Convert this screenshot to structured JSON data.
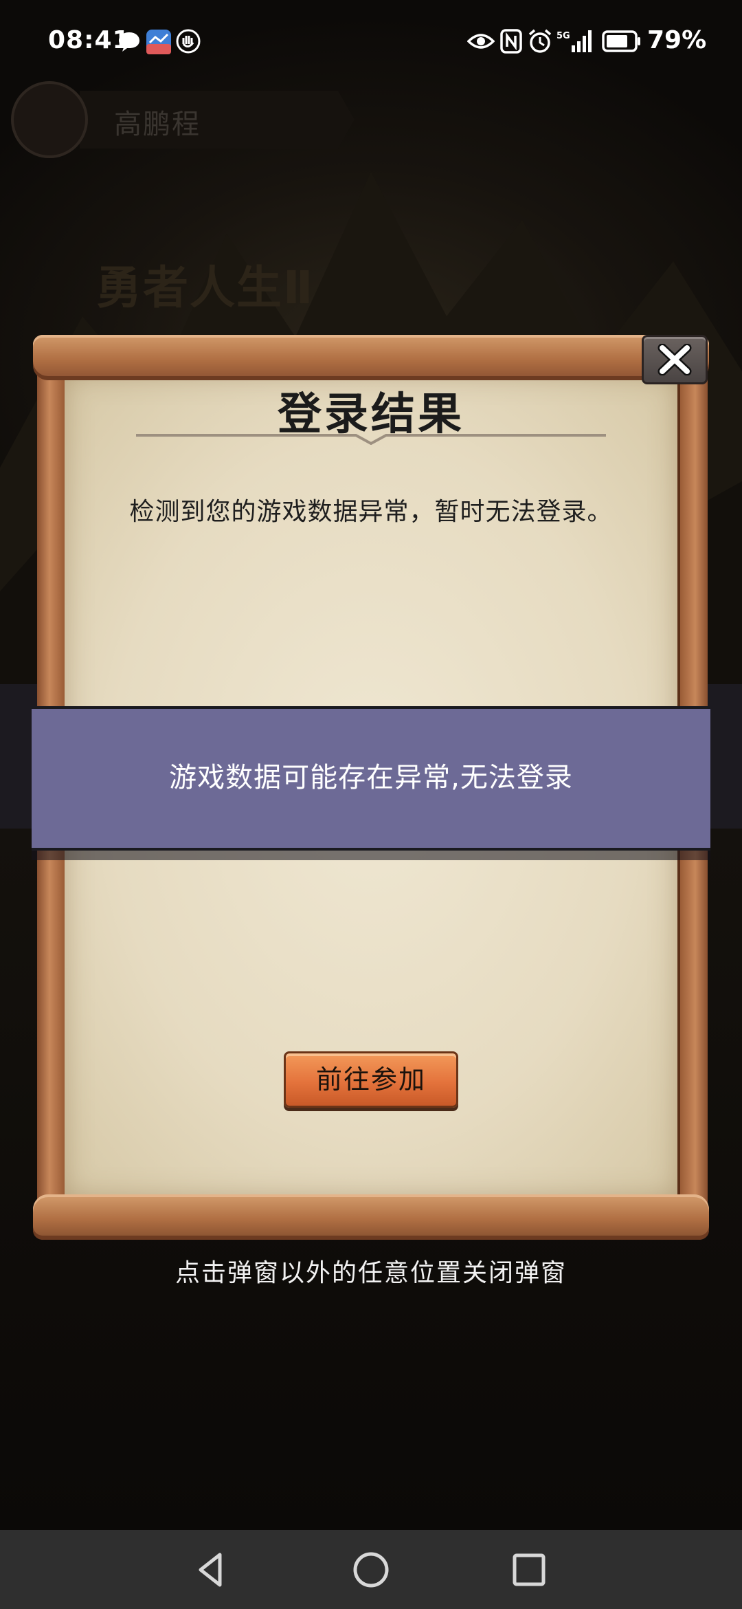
{
  "status_bar": {
    "time": "08:41",
    "battery": "79%",
    "network_label": "5G"
  },
  "background": {
    "user_name": "高鹏程",
    "game_title": "勇者人生Ⅱ"
  },
  "dialog": {
    "title": "登录结果",
    "message": "检测到您的游戏数据异常，暂时无法登录。",
    "join_button_label": "前往参加",
    "close_icon": "close-icon"
  },
  "toast": {
    "message": "游戏数据可能存在异常,无法登录"
  },
  "hint": {
    "text": "点击弹窗以外的任意位置关闭弹窗"
  },
  "nav_bar": {
    "back_icon": "back-triangle-icon",
    "home_icon": "home-circle-icon",
    "recents_icon": "recents-square-icon"
  },
  "colors": {
    "scroll_wood": "#b06f43",
    "parchment": "#e6dbc1",
    "toast_bg": "#6d6a96",
    "join_button": "#e4733c",
    "close_button": "#5a5351"
  }
}
